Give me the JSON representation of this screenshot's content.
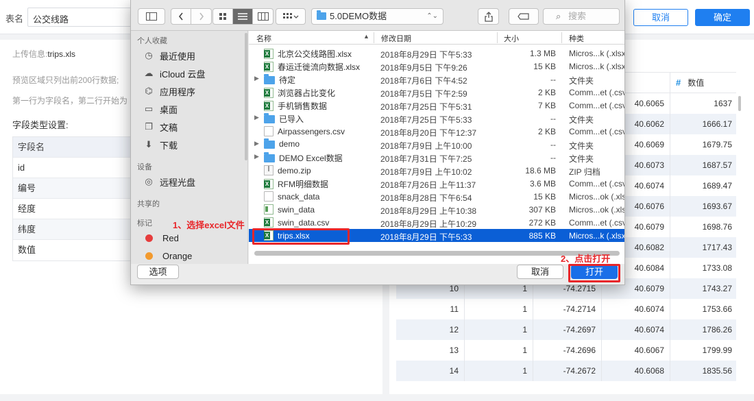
{
  "topbar": {
    "table_name_label": "表名",
    "table_name_value": "公交线路",
    "cancel_label": "取消",
    "confirm_label": "确定"
  },
  "left": {
    "upload_info_label": "上传信息:",
    "upload_file": "trips.xls",
    "preview_note": "预览区域只列出前200行数据;",
    "row_note": "第一行为字段名，第二行开始为",
    "field_type_title": "字段类型设置:",
    "field_header": "字段名",
    "fields": [
      "id",
      "编号",
      "经度",
      "纬度",
      "数值"
    ]
  },
  "right": {
    "header_partial": "纬度",
    "header_value": "数值",
    "hash_icon": "#",
    "rows": [
      {
        "id": "",
        "num": "",
        "lng": "",
        "lat": "40.6065",
        "val": "1637"
      },
      {
        "id": "",
        "num": "",
        "lng": "",
        "lat": "40.6062",
        "val": "1666.17"
      },
      {
        "id": "",
        "num": "",
        "lng": "",
        "lat": "40.6069",
        "val": "1679.75"
      },
      {
        "id": "",
        "num": "",
        "lng": "",
        "lat": "40.6073",
        "val": "1687.57"
      },
      {
        "id": "",
        "num": "",
        "lng": "",
        "lat": "40.6074",
        "val": "1689.47"
      },
      {
        "id": "",
        "num": "",
        "lng": "",
        "lat": "40.6076",
        "val": "1693.67"
      },
      {
        "id": "",
        "num": "",
        "lng": "",
        "lat": "40.6079",
        "val": "1698.76"
      },
      {
        "id": "",
        "num": "",
        "lng": "",
        "lat": "40.6082",
        "val": "1717.43"
      },
      {
        "id": "",
        "num": "",
        "lng": "",
        "lat": "40.6084",
        "val": "1733.08"
      },
      {
        "id": "10",
        "num": "1",
        "lng": "-74.2715",
        "lat": "40.6079",
        "val": "1743.27"
      },
      {
        "id": "11",
        "num": "1",
        "lng": "-74.2714",
        "lat": "40.6074",
        "val": "1753.66"
      },
      {
        "id": "12",
        "num": "1",
        "lng": "-74.2697",
        "lat": "40.6074",
        "val": "1786.26"
      },
      {
        "id": "13",
        "num": "1",
        "lng": "-74.2696",
        "lat": "40.6067",
        "val": "1799.99"
      },
      {
        "id": "14",
        "num": "1",
        "lng": "-74.2672",
        "lat": "40.6068",
        "val": "1835.56"
      }
    ]
  },
  "dialog": {
    "current_folder": "5.0DEMO数据",
    "search_placeholder": "搜索",
    "sidebar": {
      "favorites_title": "个人收藏",
      "favorites": [
        {
          "label": "最近使用",
          "icon": "clock-icon"
        },
        {
          "label": "iCloud 云盘",
          "icon": "cloud-icon"
        },
        {
          "label": "应用程序",
          "icon": "apps-icon"
        },
        {
          "label": "桌面",
          "icon": "desktop-icon"
        },
        {
          "label": "文稿",
          "icon": "document-icon"
        },
        {
          "label": "下载",
          "icon": "download-icon"
        }
      ],
      "devices_title": "设备",
      "devices": [
        {
          "label": "远程光盘",
          "icon": "disc-icon"
        }
      ],
      "shared_title": "共享的",
      "tags_title": "标记",
      "tags": [
        {
          "label": "Red",
          "color": "#e63d3d"
        },
        {
          "label": "Orange",
          "color": "#f29a2e"
        }
      ]
    },
    "columns": {
      "name": "名称",
      "date": "修改日期",
      "size": "大小",
      "kind": "种类"
    },
    "files": [
      {
        "name": "北京公交线路图.xlsx",
        "date": "2018年8月29日 下午5:33",
        "size": "1.3 MB",
        "kind": "Micros...k (.xlsx)",
        "type": "xls",
        "folder": false
      },
      {
        "name": "春运迁徙流向数据.xlsx",
        "date": "2018年9月5日 下午9:26",
        "size": "15 KB",
        "kind": "Micros...k (.xlsx)",
        "type": "xls",
        "folder": false
      },
      {
        "name": "待定",
        "date": "2018年7月6日 下午4:52",
        "size": "--",
        "kind": "文件夹",
        "type": "fold",
        "folder": true
      },
      {
        "name": "浏览器占比变化",
        "date": "2018年7月5日 下午2:59",
        "size": "2 KB",
        "kind": "Comm...et (.csv)",
        "type": "xls",
        "folder": false
      },
      {
        "name": "手机销售数据",
        "date": "2018年7月25日 下午5:31",
        "size": "7 KB",
        "kind": "Comm...et (.csv)",
        "type": "xls",
        "folder": false
      },
      {
        "name": "已导入",
        "date": "2018年7月25日 下午5:33",
        "size": "--",
        "kind": "文件夹",
        "type": "fold",
        "folder": true
      },
      {
        "name": "Airpassengers.csv",
        "date": "2018年8月20日 下午12:37",
        "size": "2 KB",
        "kind": "Comm...et (.csv)",
        "type": "doc",
        "folder": false
      },
      {
        "name": "demo",
        "date": "2018年7月9日 上午10:00",
        "size": "--",
        "kind": "文件夹",
        "type": "fold",
        "folder": true
      },
      {
        "name": "DEMO Excel数据",
        "date": "2018年7月31日 下午7:25",
        "size": "--",
        "kind": "文件夹",
        "type": "fold",
        "folder": true
      },
      {
        "name": "demo.zip",
        "date": "2018年7月9日 上午10:02",
        "size": "18.6 MB",
        "kind": "ZIP 归档",
        "type": "zip",
        "folder": false
      },
      {
        "name": "RFM明细数据",
        "date": "2018年7月26日 上午11:37",
        "size": "3.6 MB",
        "kind": "Comm...et (.csv)",
        "type": "xls",
        "folder": false
      },
      {
        "name": "snack_data",
        "date": "2018年8月28日 下午6:54",
        "size": "15 KB",
        "kind": "Micros...ok (.xlsx)",
        "type": "doc",
        "folder": false
      },
      {
        "name": "swin_data",
        "date": "2018年8月29日 上午10:38",
        "size": "307 KB",
        "kind": "Micros...ok (.xlsx)",
        "type": "csv",
        "folder": false
      },
      {
        "name": "swin_data.csv",
        "date": "2018年8月29日 上午10:29",
        "size": "272 KB",
        "kind": "Comm...et (.csv)",
        "type": "xls",
        "folder": false
      },
      {
        "name": "trips.xlsx",
        "date": "2018年8月29日 下午5:33",
        "size": "885 KB",
        "kind": "Micros...k (.xlsx)",
        "type": "xls",
        "folder": false,
        "selected": true
      }
    ],
    "options_label": "选项",
    "cancel_label": "取消",
    "open_label": "打开"
  },
  "annotations": {
    "step1": "1、选择excel文件",
    "step2": "2、点击打开",
    "color": "#e8262a"
  }
}
